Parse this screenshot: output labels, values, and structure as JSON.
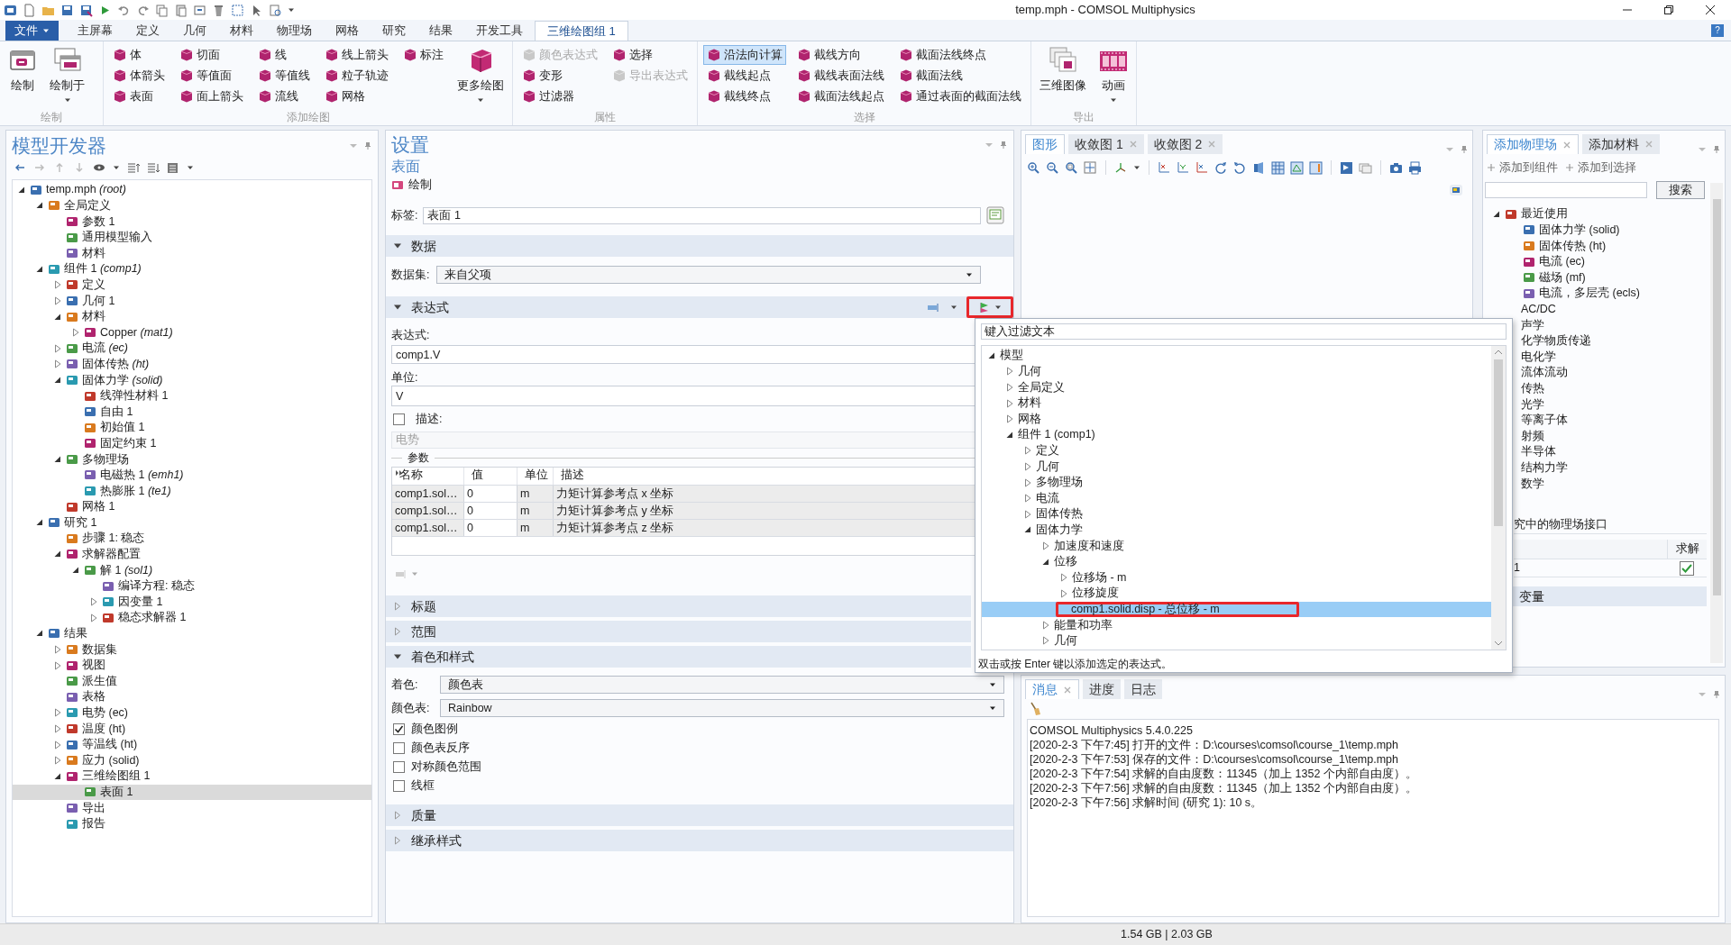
{
  "window": {
    "title": "temp.mph - COMSOL Multiphysics"
  },
  "ribbon": {
    "help": "?",
    "tabs": [
      {
        "label": "文件",
        "kind": "file",
        "selected": false
      },
      {
        "label": "主屏幕",
        "kind": "tab",
        "selected": false
      },
      {
        "label": "定义",
        "kind": "tab",
        "selected": false
      },
      {
        "label": "几何",
        "kind": "tab",
        "selected": false
      },
      {
        "label": "材料",
        "kind": "tab",
        "selected": false
      },
      {
        "label": "物理场",
        "kind": "tab",
        "selected": false
      },
      {
        "label": "网格",
        "kind": "tab",
        "selected": false
      },
      {
        "label": "研究",
        "kind": "tab",
        "selected": false
      },
      {
        "label": "结果",
        "kind": "tab",
        "selected": false
      },
      {
        "label": "开发工具",
        "kind": "tab",
        "selected": false
      },
      {
        "label": "三维绘图组 1",
        "kind": "tab",
        "selected": true
      }
    ],
    "groups": [
      {
        "title": "绘制",
        "columns": [
          {
            "kind": "big",
            "label": "绘制",
            "dropdown": false
          },
          {
            "kind": "big",
            "label": "绘制于",
            "dropdown": true
          }
        ]
      },
      {
        "title": "添加绘图",
        "columns": [
          {
            "kind": "stack",
            "items": [
              {
                "label": "体",
                "disabled": false,
                "on": false
              },
              {
                "label": "体箭头",
                "disabled": false,
                "on": false
              },
              {
                "label": "表面",
                "disabled": false,
                "on": false
              }
            ]
          },
          {
            "kind": "stack",
            "items": [
              {
                "label": "切面",
                "disabled": false,
                "on": false
              },
              {
                "label": "等值面",
                "disabled": false,
                "on": false
              },
              {
                "label": "面上箭头",
                "disabled": false,
                "on": false
              }
            ]
          },
          {
            "kind": "stack",
            "items": [
              {
                "label": "线",
                "disabled": false,
                "on": false
              },
              {
                "label": "等值线",
                "disabled": false,
                "on": false
              },
              {
                "label": "流线",
                "disabled": false,
                "on": false
              }
            ]
          },
          {
            "kind": "stack",
            "items": [
              {
                "label": "线上箭头",
                "disabled": false,
                "on": false
              },
              {
                "label": "粒子轨迹",
                "disabled": false,
                "on": false
              },
              {
                "label": "网格",
                "disabled": false,
                "on": false
              }
            ]
          },
          {
            "kind": "stack",
            "items": [
              {
                "label": "标注",
                "disabled": false,
                "on": false
              }
            ]
          },
          {
            "kind": "big",
            "label": "更多绘图",
            "dropdown": true
          }
        ]
      },
      {
        "title": "属性",
        "columns": [
          {
            "kind": "stack",
            "items": [
              {
                "label": "颜色表达式",
                "disabled": true,
                "on": false
              },
              {
                "label": "变形",
                "disabled": false,
                "on": false
              },
              {
                "label": "过滤器",
                "disabled": false,
                "on": false
              }
            ]
          },
          {
            "kind": "stack",
            "items": [
              {
                "label": "选择",
                "disabled": false,
                "on": false
              },
              {
                "label": "导出表达式",
                "disabled": true,
                "on": false
              }
            ]
          }
        ]
      },
      {
        "title": "选择",
        "columns": [
          {
            "kind": "stack",
            "items": [
              {
                "label": "沿法向计算",
                "disabled": false,
                "on": true
              },
              {
                "label": "截线起点",
                "disabled": false,
                "on": false
              },
              {
                "label": "截线终点",
                "disabled": false,
                "on": false
              }
            ]
          },
          {
            "kind": "stack",
            "items": [
              {
                "label": "截线方向",
                "disabled": false,
                "on": false
              },
              {
                "label": "截线表面法线",
                "disabled": false,
                "on": false
              },
              {
                "label": "截面法线起点",
                "disabled": false,
                "on": false
              }
            ]
          },
          {
            "kind": "stack",
            "items": [
              {
                "label": "截面法线终点",
                "disabled": false,
                "on": false
              },
              {
                "label": "截面法线",
                "disabled": false,
                "on": false
              },
              {
                "label": "通过表面的截面法线",
                "disabled": false,
                "on": false
              }
            ]
          }
        ]
      },
      {
        "title": "导出",
        "columns": [
          {
            "kind": "big",
            "label": "三维图像",
            "dropdown": false
          },
          {
            "kind": "big",
            "label": "动画",
            "dropdown": true
          }
        ]
      }
    ]
  },
  "model_builder": {
    "title": "模型开发器",
    "tree": [
      {
        "label": "temp.mph *(root)*",
        "expanded": true,
        "selected": false,
        "children": [
          {
            "label": "全局定义",
            "expanded": true,
            "selected": false,
            "children": [
              {
                "label": "参数 1",
                "selected": false
              },
              {
                "label": "通用模型输入",
                "selected": false
              },
              {
                "label": "材料",
                "selected": false
              }
            ]
          },
          {
            "label": "组件 1 *(comp1)*",
            "expanded": true,
            "selected": false,
            "children": [
              {
                "label": "定义",
                "expanded": false,
                "selected": false
              },
              {
                "label": "几何 1",
                "expanded": false,
                "selected": false
              },
              {
                "label": "材料",
                "expanded": true,
                "selected": false,
                "children": [
                  {
                    "label": "Copper *(mat1)*",
                    "expanded": false,
                    "selected": false
                  }
                ]
              },
              {
                "label": "电流 *(ec)*",
                "expanded": false,
                "selected": false
              },
              {
                "label": "固体传热 *(ht)*",
                "expanded": false,
                "selected": false
              },
              {
                "label": "固体力学 *(solid)*",
                "expanded": true,
                "selected": false,
                "children": [
                  {
                    "label": "线弹性材料 1",
                    "selected": false
                  },
                  {
                    "label": "自由 1",
                    "selected": false
                  },
                  {
                    "label": "初始值 1",
                    "selected": false
                  },
                  {
                    "label": "固定约束 1",
                    "selected": false
                  }
                ]
              },
              {
                "label": "多物理场",
                "expanded": true,
                "selected": false,
                "children": [
                  {
                    "label": "电磁热 1 *(emh1)*",
                    "selected": false
                  },
                  {
                    "label": "热膨胀 1 *(te1)*",
                    "selected": false
                  }
                ]
              },
              {
                "label": "网格 1",
                "selected": false
              }
            ]
          },
          {
            "label": "研究 1",
            "expanded": true,
            "selected": false,
            "children": [
              {
                "label": "步骤 1: 稳态",
                "selected": false
              },
              {
                "label": "求解器配置",
                "expanded": true,
                "selected": false,
                "children": [
                  {
                    "label": "解 1 *(sol1)*",
                    "expanded": true,
                    "selected": false,
                    "children": [
                      {
                        "label": "编译方程: 稳态",
                        "selected": false
                      },
                      {
                        "label": "因变量 1",
                        "expanded": false,
                        "selected": false
                      },
                      {
                        "label": "稳态求解器 1",
                        "expanded": false,
                        "selected": false
                      }
                    ]
                  }
                ]
              }
            ]
          },
          {
            "label": "结果",
            "expanded": true,
            "selected": false,
            "children": [
              {
                "label": "数据集",
                "expanded": false,
                "selected": false
              },
              {
                "label": "视图",
                "expanded": false,
                "selected": false
              },
              {
                "label": "派生值",
                "selected": false
              },
              {
                "label": "表格",
                "selected": false
              },
              {
                "label": "电势 (ec)",
                "expanded": false,
                "selected": false
              },
              {
                "label": "温度 (ht)",
                "expanded": false,
                "selected": false
              },
              {
                "label": "等温线 (ht)",
                "expanded": false,
                "selected": false
              },
              {
                "label": "应力 (solid)",
                "expanded": false,
                "selected": false
              },
              {
                "label": "三维绘图组 1",
                "expanded": true,
                "selected": false,
                "children": [
                  {
                    "label": "表面 1",
                    "selected": true
                  }
                ]
              },
              {
                "label": "导出",
                "selected": false
              },
              {
                "label": "报告",
                "selected": false
              }
            ]
          }
        ]
      }
    ]
  },
  "settings": {
    "title": "设置",
    "subtitle": "表面",
    "plot_button": "绘制",
    "label_caption": "标签:",
    "label_value": "表面 1",
    "sections": [
      {
        "kind": "data",
        "title": "数据",
        "expanded": true,
        "dataset_label": "数据集:",
        "dataset": "来自父项"
      },
      {
        "kind": "expression",
        "title": "表达式",
        "expanded": true,
        "insert_outlined": true,
        "expression_label": "表达式:",
        "expression": "comp1.V",
        "unit_label": "单位:",
        "unit": "V",
        "description": {
          "label": "描述:",
          "checked": false,
          "value": "电势"
        },
        "parameters": {
          "title": "参数",
          "columns": [
            "名称",
            "值",
            "单位",
            "描述"
          ],
          "rows": [
            [
              "comp1.sol…",
              "0",
              "m",
              "力矩计算参考点 x 坐标"
            ],
            [
              "comp1.sol…",
              "0",
              "m",
              "力矩计算参考点 y 坐标"
            ],
            [
              "comp1.sol…",
              "0",
              "m",
              "力矩计算参考点 z 坐标"
            ]
          ]
        }
      },
      {
        "title": "标题",
        "expanded": false
      },
      {
        "title": "范围",
        "expanded": false
      },
      {
        "kind": "coloring",
        "title": "着色和样式",
        "expanded": true,
        "coloring_label": "着色:",
        "coloring": "颜色表",
        "table_label": "颜色表:",
        "table": "Rainbow",
        "options": [
          {
            "label": "颜色图例",
            "checked": true
          },
          {
            "label": "颜色表反序",
            "checked": false
          },
          {
            "label": "对称颜色范围",
            "checked": false
          },
          {
            "label": "线框",
            "checked": false
          }
        ]
      },
      {
        "title": "质量",
        "expanded": false
      },
      {
        "title": "继承样式",
        "expanded": false
      }
    ]
  },
  "graphics": {
    "tabs": [
      {
        "label": "图形",
        "selected": true,
        "closable": false
      },
      {
        "label": "收敛图 1",
        "selected": false,
        "closable": true
      },
      {
        "label": "收敛图 2",
        "selected": false,
        "closable": true
      }
    ]
  },
  "physics": {
    "tabs": [
      {
        "label": "添加物理场",
        "selected": true,
        "closable": true
      },
      {
        "label": "添加材料",
        "selected": false,
        "closable": true
      }
    ],
    "actions": [
      "添加到组件",
      "添加到选择"
    ],
    "search_button": "搜索",
    "tree": [
      {
        "label": "最近使用",
        "expanded": true,
        "selected": false,
        "children": [
          {
            "label": "固体力学 (solid)",
            "selected": false
          },
          {
            "label": "固体传热 (ht)",
            "selected": false
          },
          {
            "label": "电流 (ec)",
            "selected": false
          },
          {
            "label": "磁场 (mf)",
            "selected": false
          },
          {
            "label": "电流，多层壳 (ecls)",
            "selected": false
          }
        ]
      },
      {
        "label": "AC/DC",
        "selected": false
      },
      {
        "label": "声学",
        "selected": false
      },
      {
        "label": "化学物质传递",
        "selected": false
      },
      {
        "label": "电化学",
        "selected": false
      },
      {
        "label": "流体流动",
        "selected": false
      },
      {
        "label": "传热",
        "selected": false
      },
      {
        "label": "光学",
        "selected": false
      },
      {
        "label": "等离子体",
        "selected": false
      },
      {
        "label": "射频",
        "selected": false
      },
      {
        "label": "半导体",
        "selected": false
      },
      {
        "label": "结构力学",
        "selected": false
      },
      {
        "label": "数学",
        "selected": false
      }
    ],
    "interfaces_title": "究中的物理场接口",
    "solve_column": "求解",
    "interfaces": [
      {
        "name": "1",
        "solve": true
      }
    ],
    "variables_title": "变量"
  },
  "messages": {
    "tabs": [
      {
        "label": "消息",
        "selected": true,
        "closable": true
      },
      {
        "label": "进度",
        "selected": false,
        "closable": false
      },
      {
        "label": "日志",
        "selected": false,
        "closable": false
      }
    ],
    "lines": [
      "COMSOL Multiphysics 5.4.0.225",
      "[2020-2-3 下午7:45] 打开的文件：D:\\courses\\comsol\\course_1\\temp.mph",
      "[2020-2-3 下午7:53] 保存的文件：D:\\courses\\comsol\\course_1\\temp.mph",
      "[2020-2-3 下午7:54] 求解的自由度数：11345（加上 1352 个内部自由度）。",
      "[2020-2-3 下午7:56] 求解的自由度数：11345（加上 1352 个内部自由度）。",
      "[2020-2-3 下午7:56] 求解时间 (研究 1): 10 s。"
    ]
  },
  "popup": {
    "filter_placeholder": "键入过滤文本",
    "outline_selected": true,
    "tree": [
      {
        "label": "模型",
        "expanded": true,
        "selected": false,
        "children": [
          {
            "label": "几何",
            "expanded": false,
            "selected": false
          },
          {
            "label": "全局定义",
            "expanded": false,
            "selected": false
          },
          {
            "label": "材料",
            "expanded": false,
            "selected": false
          },
          {
            "label": "网格",
            "expanded": false,
            "selected": false
          },
          {
            "label": "组件 1 (comp1)",
            "expanded": true,
            "selected": false,
            "children": [
              {
                "label": "定义",
                "expanded": false,
                "selected": false
              },
              {
                "label": "几何",
                "expanded": false,
                "selected": false
              },
              {
                "label": "多物理场",
                "expanded": false,
                "selected": false
              },
              {
                "label": "电流",
                "expanded": false,
                "selected": false
              },
              {
                "label": "固体传热",
                "expanded": false,
                "selected": false
              },
              {
                "label": "固体力学",
                "expanded": true,
                "selected": false,
                "children": [
                  {
                    "label": "加速度和速度",
                    "expanded": false,
                    "selected": false
                  },
                  {
                    "label": "位移",
                    "expanded": true,
                    "selected": false,
                    "children": [
                      {
                        "label": "位移场 - m",
                        "expanded": false,
                        "selected": false
                      },
                      {
                        "label": "位移旋度",
                        "expanded": false,
                        "selected": false
                      },
                      {
                        "label": "comp1.solid.disp - 总位移 - m",
                        "selected": true
                      }
                    ]
                  },
                  {
                    "label": "能量和功率",
                    "expanded": false,
                    "selected": false
                  },
                  {
                    "label": "几何",
                    "expanded": false,
                    "selected": false
                  }
                ]
              }
            ]
          }
        ]
      }
    ],
    "hint": "双击或按 Enter 键以添加选定的表达式。"
  },
  "status_bar": {
    "memory": "1.54 GB | 2.03 GB"
  }
}
